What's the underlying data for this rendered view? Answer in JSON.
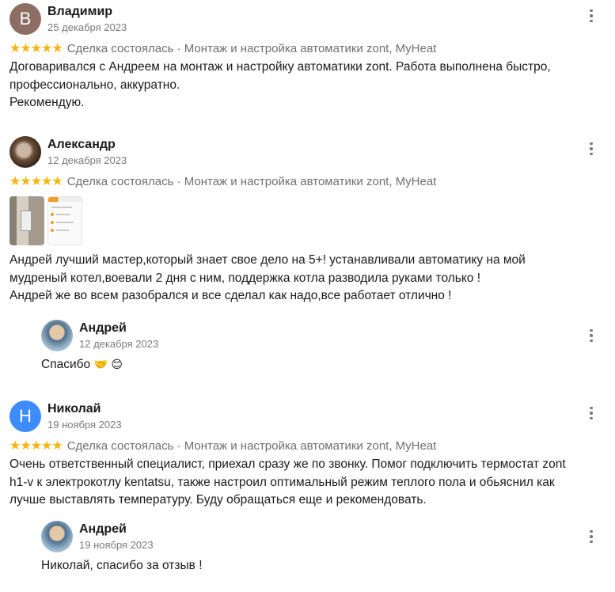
{
  "reviews": [
    {
      "avatar_letter": "В",
      "name": "Владимир",
      "date": "25 декабря 2023",
      "stars": "★★★★★",
      "meta": "Сделка состоялась · Монтаж и настройка автоматики zont, MyHeat",
      "text_lines": [
        "Договаривался с Андреем на монтаж и настройку автоматики zont. Работа выполнена быстро, профессионально, аккуратно.",
        "Рекомендую."
      ]
    },
    {
      "name": "Александр",
      "date": "12 декабря 2023",
      "stars": "★★★★★",
      "meta": "Сделка состоялась · Монтаж и настройка автоматики zont, MyHeat",
      "text_lines": [
        "Андрей лучший мастер,который знает свое дело на 5+! устанавливали автоматику на мой мудреный котел,воевали 2 дня с ним, поддержка котла разводила руками только !",
        "Андрей же во всем разобрался и все сделал как надо,все работает отлично !"
      ],
      "reply": {
        "name": "Андрей",
        "date": "12 декабря 2023",
        "text": "Спасибо",
        "emoji": "🤝 😊"
      }
    },
    {
      "avatar_letter": "Н",
      "name": "Николай",
      "date": "19 ноября 2023",
      "stars": "★★★★★",
      "meta": "Сделка состоялась · Монтаж и настройка автоматики zont, MyHeat",
      "text_lines": [
        "Очень ответственный специалист, приехал сразу же по звонку. Помог подключить термостат zont h1-v к электрокотлу kentatsu, также настроил оптимальный режим теплого пола и обьяснил как лучше выставлять температуру. Буду обращаться еще и рекомендовать."
      ],
      "reply": {
        "name": "Андрей",
        "date": "19 ноября 2023",
        "text": "Николай, спасибо за отзыв !"
      }
    }
  ],
  "colors": {
    "stars": "#f6b40e",
    "avatar_v": "#8d6e63",
    "avatar_n": "#3d8bfd",
    "meta_text": "#6f6f6f"
  },
  "icons": {
    "more": "more-vertical-icon",
    "star": "star-icon"
  }
}
